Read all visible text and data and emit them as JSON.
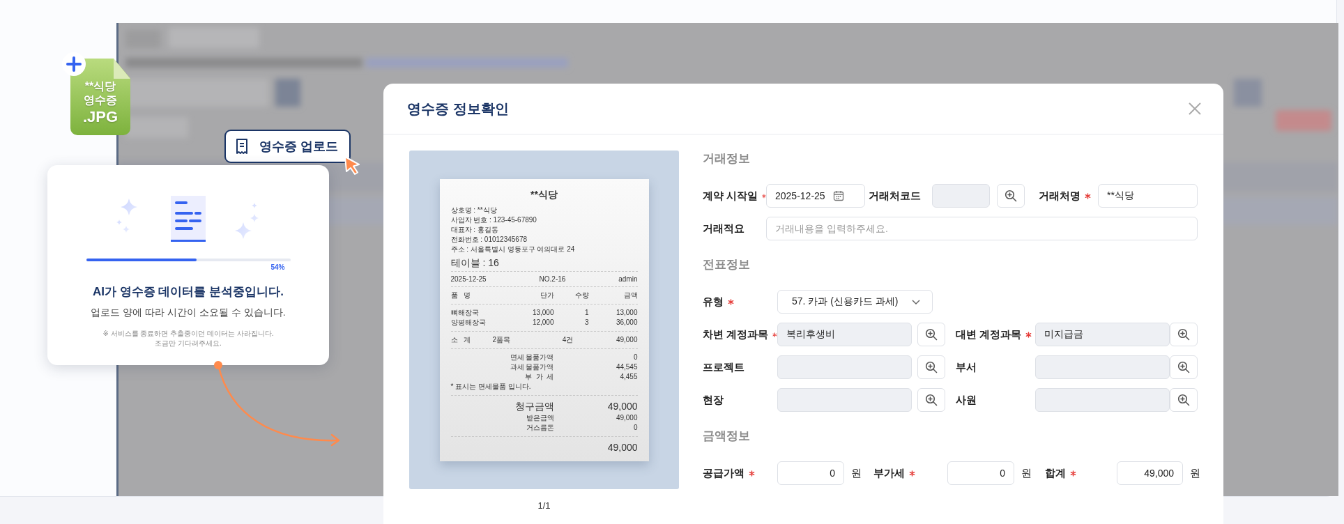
{
  "file_badge": {
    "lines": [
      "**식당",
      "영수증",
      ".JPG"
    ]
  },
  "upload_button": {
    "label": "영수증 업로드"
  },
  "analysis_card": {
    "progress": {
      "level": 0.54,
      "reading": "54%"
    },
    "title": "AI가 영수증 데이터를 분석중입니다.",
    "subtitle": "업로드 양에 따라 시간이 소요될 수 있습니다.",
    "notes": [
      "※ 서비스를 종료하면 추출중이던 데이터는 사라집니다.",
      "조금만 기다려주세요."
    ]
  },
  "modal": {
    "title": "영수증 정보확인",
    "pager": "1/1",
    "receipt": {
      "store": "**식당",
      "info": [
        "상호명 : **식당",
        "사업자 번호 : 123-45-67890",
        "대표자 : 홍길동",
        "전화번호 : 01012345678",
        "주소 : 서울특별시 영등포구 여의대로 24"
      ],
      "table_no": "테이블 : 16",
      "meta": [
        "2025-12-25",
        "NO.2-16",
        "admin"
      ],
      "item_header": [
        "품   명",
        "단가",
        "수량",
        "금액"
      ],
      "items": [
        [
          "뼈해장국",
          "13,000",
          "1",
          "13,000"
        ],
        [
          "양평해장국",
          "12,000",
          "3",
          "36,000"
        ]
      ],
      "subtotal": [
        "소   계",
        "2품목",
        "4건",
        "49,000"
      ],
      "tax_rows": [
        [
          "면세 물품가액",
          "0"
        ],
        [
          "과세 물품가액",
          "44,545"
        ],
        [
          "부  가  세",
          "4,455"
        ]
      ],
      "tax_note": "* 표시는 면세물품 입니다.",
      "charge": [
        "청구금액",
        "49,000"
      ],
      "paid_rows": [
        [
          "받은금액",
          "49,000"
        ],
        [
          "거스름돈",
          "0"
        ]
      ],
      "total": "49,000"
    },
    "sections": [
      {
        "title": "거래정보",
        "rows": [
          {
            "kind": "triple",
            "fields": [
              {
                "label": "계약 시작일",
                "required": true,
                "kind": "date",
                "value": "2025-12-25"
              },
              {
                "label": "거래처코드",
                "required": false,
                "kind": "lookup"
              },
              {
                "label": "거래처명",
                "required": true,
                "kind": "text",
                "value": "**식당"
              }
            ]
          },
          {
            "kind": "wide",
            "fields": [
              {
                "label": "거래적요",
                "required": false,
                "kind": "text",
                "placeholder": "거래내용을 입력하주세요."
              }
            ]
          }
        ]
      },
      {
        "title": "전표정보",
        "rows": [
          {
            "kind": "single",
            "fields": [
              {
                "label": "유형",
                "required": true,
                "kind": "select",
                "value": "57. 카과 (신용카드 과세)"
              }
            ]
          },
          {
            "kind": "double",
            "fields": [
              {
                "label": "차변 계정과목",
                "required": true,
                "kind": "lookup",
                "value": "복리후생비"
              },
              {
                "label": "대변 계정과목",
                "required": true,
                "kind": "lookup",
                "value": "미지급금"
              }
            ]
          },
          {
            "kind": "double",
            "fields": [
              {
                "label": "프로젝트",
                "required": false,
                "kind": "lookup"
              },
              {
                "label": "부서",
                "required": false,
                "kind": "lookup"
              }
            ]
          },
          {
            "kind": "double",
            "fields": [
              {
                "label": "현장",
                "required": false,
                "kind": "lookup"
              },
              {
                "label": "사원",
                "required": false,
                "kind": "lookup"
              }
            ]
          }
        ]
      },
      {
        "title": "금액정보",
        "rows": [
          {
            "kind": "money",
            "fields": [
              {
                "label": "공급가액",
                "required": true,
                "kind": "amount",
                "value": "0",
                "unit": "원"
              },
              {
                "label": "부가세",
                "required": true,
                "kind": "amount",
                "value": "0",
                "unit": "원"
              },
              {
                "label": "합계",
                "required": true,
                "kind": "amount",
                "value": "49,000",
                "unit": "원"
              }
            ]
          }
        ]
      }
    ]
  }
}
